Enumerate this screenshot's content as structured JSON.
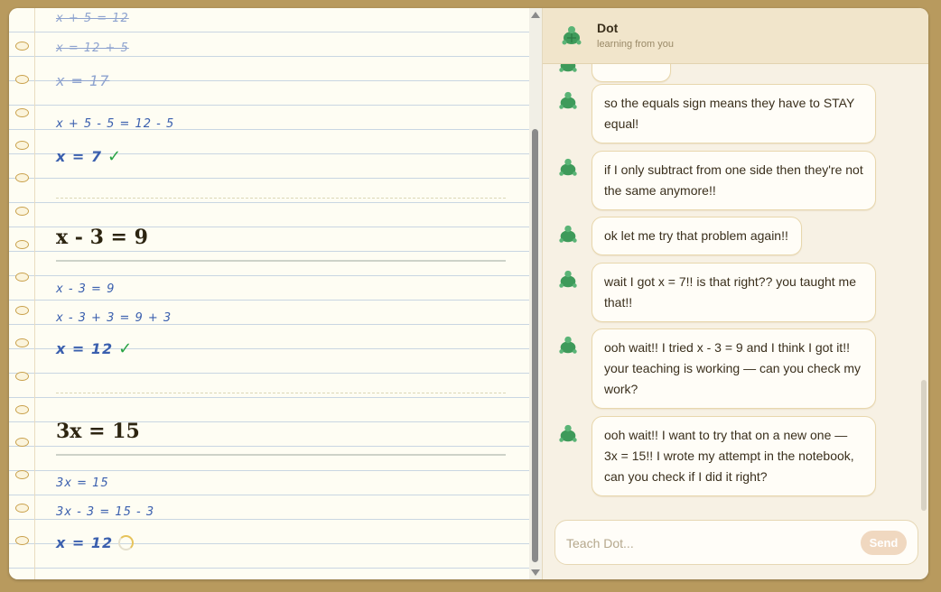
{
  "notebook": {
    "struck_lines": [
      "x + 5 = 12",
      "x = 12 + 5",
      "x = 17"
    ],
    "problem1": {
      "steps": [
        "x + 5 - 5 = 12 - 5",
        "x = 7"
      ]
    },
    "problem2": {
      "heading": "x - 3 = 9",
      "steps": [
        "x - 3 = 9",
        "x - 3 + 3 = 9 + 3",
        "x = 12"
      ]
    },
    "problem3": {
      "heading": "3x = 15",
      "steps": [
        "3x = 15",
        "3x - 3 = 15 - 3",
        "x = 12"
      ]
    },
    "checkmark": "✓"
  },
  "chat": {
    "name": "Dot",
    "status": "learning from you",
    "messages": [
      "so the equals sign means they have to STAY equal!",
      "if I only subtract from one side then they're not the same anymore!!",
      "ok let me try that problem again!!",
      "wait I got x = 7!! is that right?? you taught me that!!",
      "ooh wait!! I tried x - 3 = 9 and I think I got it!! your teaching is working — can you check my work?",
      "ooh wait!! I want to try that on a new one — 3x = 15!! I wrote my attempt in the notebook, can you check if I did it right?"
    ],
    "placeholder": "Teach Dot...",
    "send_label": "Send"
  },
  "icons": {
    "avatar": "turtle-icon"
  },
  "colors": {
    "ink": "#3a5fae",
    "check": "#27a344",
    "accent": "#c9a14c"
  }
}
